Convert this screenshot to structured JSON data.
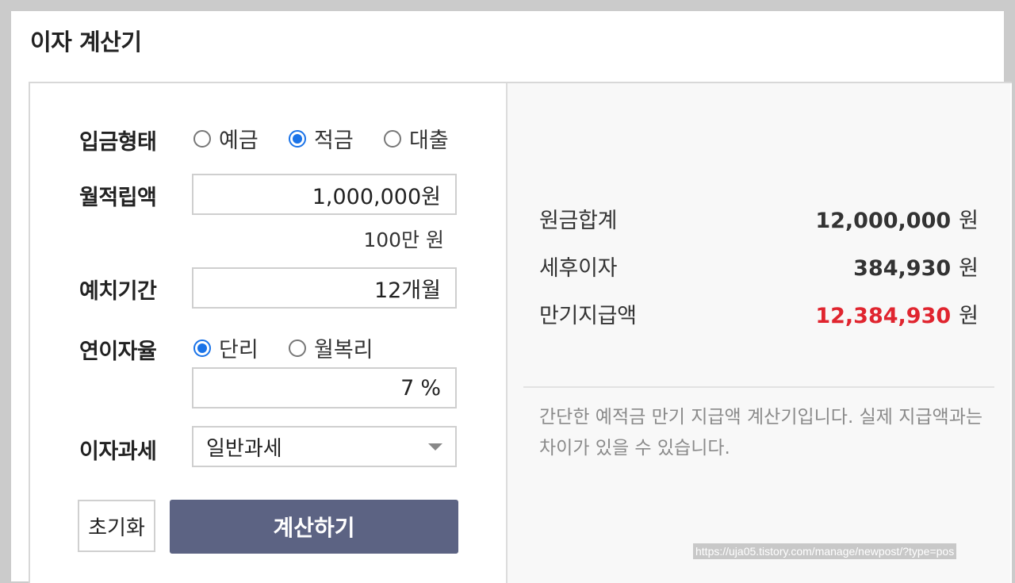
{
  "page": {
    "title": "이자 계산기"
  },
  "form": {
    "deposit_type": {
      "label": "입금형태",
      "options": [
        {
          "label": "예금",
          "selected": false
        },
        {
          "label": "적금",
          "selected": true
        },
        {
          "label": "대출",
          "selected": false
        }
      ]
    },
    "monthly_amount": {
      "label": "월적립액",
      "value": "1,000,000원",
      "hint": "100만 원"
    },
    "period": {
      "label": "예치기간",
      "value": "12개월"
    },
    "interest_rate": {
      "label": "연이자율",
      "options": [
        {
          "label": "단리",
          "selected": true
        },
        {
          "label": "월복리",
          "selected": false
        }
      ],
      "value": "7",
      "unit": "%"
    },
    "taxation": {
      "label": "이자과세",
      "selected": "일반과세"
    },
    "buttons": {
      "reset": "초기화",
      "calculate": "계산하기"
    }
  },
  "results": [
    {
      "label": "원금합계",
      "value": "12,000,000",
      "unit": "원",
      "highlight": false
    },
    {
      "label": "세후이자",
      "value": "384,930",
      "unit": "원",
      "highlight": false
    },
    {
      "label": "만기지급액",
      "value": "12,384,930",
      "unit": "원",
      "highlight": true
    }
  ],
  "note": "간단한 예적금 만기 지급액 계산기입니다. 실제 지급액과는 차이가 있을 수 있습니다.",
  "url_tag": "https://uja05.tistory.com/manage/newpost/?type=pos",
  "colors": {
    "accent": "#1a73e8",
    "button": "#5c6383",
    "highlight": "#e0252f"
  }
}
